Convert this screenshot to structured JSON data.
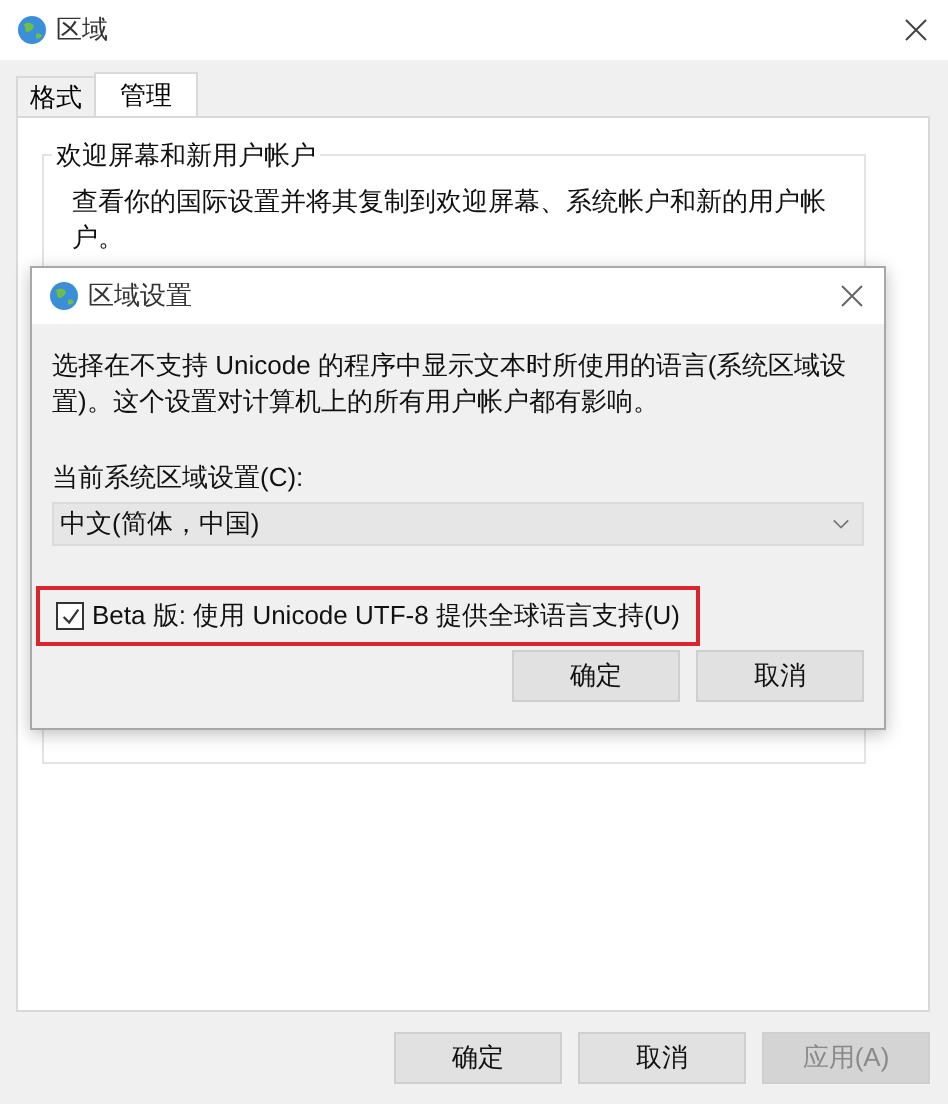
{
  "window": {
    "title": "区域"
  },
  "tabs": [
    {
      "label": "格式",
      "selected": false
    },
    {
      "label": "管理",
      "selected": true
    }
  ],
  "group": {
    "title": "欢迎屏幕和新用户帐户",
    "text": "查看你的国际设置并将其复制到欢迎屏幕、系统帐户和新的用户帐户。"
  },
  "dialog": {
    "title": "区域设置",
    "description": "选择在不支持 Unicode 的程序中显示文本时所使用的语言(系统区域设置)。这个设置对计算机上的所有用户帐户都有影响。",
    "locale_label": "当前系统区域设置(C):",
    "locale_value": "中文(简体，中国)",
    "utf8_option": {
      "label": "Beta 版: 使用 Unicode UTF-8 提供全球语言支持(U)",
      "checked": true,
      "highlighted": true
    },
    "buttons": [
      {
        "label": "确定",
        "disabled": false
      },
      {
        "label": "取消",
        "disabled": false
      }
    ]
  },
  "buttons": [
    {
      "label": "确定",
      "disabled": false
    },
    {
      "label": "取消",
      "disabled": false
    },
    {
      "label": "应用(A)",
      "disabled": true
    }
  ]
}
